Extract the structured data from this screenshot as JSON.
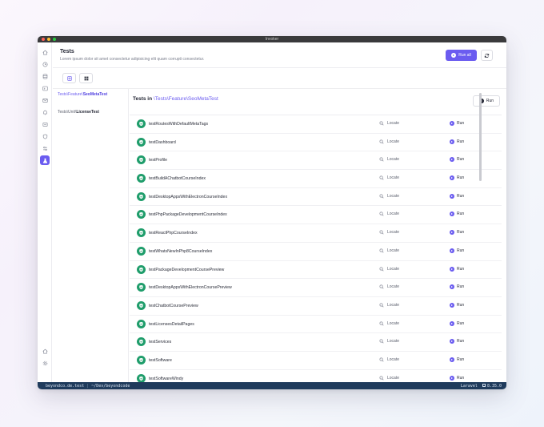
{
  "window": {
    "title": "Invoker"
  },
  "header": {
    "title": "Tests",
    "subtitle": "Lorem ipsum dolor sit amet consectetur adipisicing elit quam corrupti consectetur.",
    "run_all_label": "Run all"
  },
  "sidebar_icons": [
    "home-icon",
    "clock-icon",
    "database-icon",
    "terminal-icon",
    "mail-icon",
    "bell-icon",
    "cache-icon",
    "shield-icon",
    "switches-icon",
    "tests-icon",
    "house-icon",
    "settings-icon"
  ],
  "files": [
    {
      "prefix": "Tests\\Feature\\",
      "name": "SeoMetaTest",
      "selected": true
    },
    {
      "prefix": "Tests\\Unit\\",
      "name": "LicenseTest",
      "selected": false
    }
  ],
  "tests_panel": {
    "title_prefix": "Tests in",
    "path_prefix": "\\Tests\\Feature\\",
    "path_name": "SeoMetaTest",
    "run_label": "Run",
    "locate_label": "Locate",
    "row_run_label": "Run"
  },
  "tests": [
    "testRoutesWithDefaultMetaTags",
    "testDashboard",
    "testProfile",
    "testBuildAChatbotCourseIndex",
    "testDesktopAppsWithElectronCourseIndex",
    "testPhpPackageDevelopmentCourseIndex",
    "testReactPhpCourseIndex",
    "testWhatsNewInPhp8CourseIndex",
    "testPackageDevelopmentCoursePreview",
    "testDesktopAppsWithElectronCoursePreview",
    "testChatbotCoursePreview",
    "testLicensesDetailPages",
    "testServices",
    "testSoftware",
    "testSoftwareWindy"
  ],
  "statusbar": {
    "host": "beyondco.de.test",
    "path": "~/Dev/beyondcode",
    "framework": "Laravel",
    "version": "8.35.0"
  },
  "colors": {
    "accent": "#6b5cf0",
    "success": "#1f9d6b",
    "statusbar": "#1f3b5c"
  }
}
